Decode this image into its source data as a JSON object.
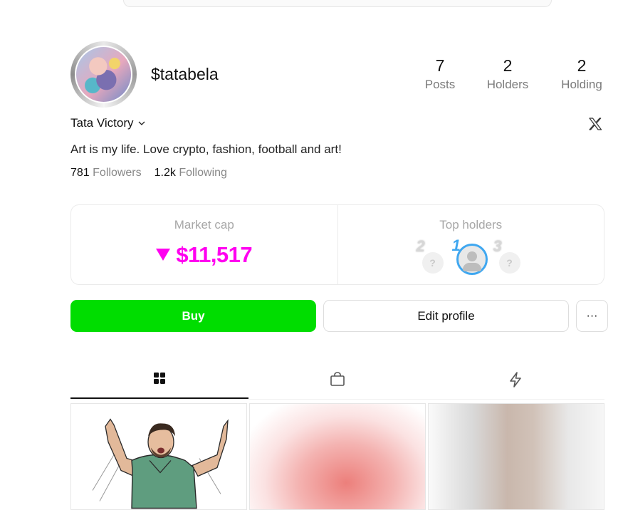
{
  "profile": {
    "handle": "$tatabela",
    "display_name": "Tata Victory",
    "bio": "Art is my life. Love crypto, fashion, football and art!",
    "followers_count": "781",
    "followers_label": "Followers",
    "following_count": "1.2k",
    "following_label": "Following"
  },
  "stats": [
    {
      "value": "7",
      "label": "Posts"
    },
    {
      "value": "2",
      "label": "Holders"
    },
    {
      "value": "2",
      "label": "Holding"
    }
  ],
  "market": {
    "label": "Market cap",
    "value": "$11,517",
    "trend": "down"
  },
  "top_holders": {
    "label": "Top holders",
    "ranks": [
      "2",
      "1",
      "3"
    ]
  },
  "actions": {
    "buy_label": "Buy",
    "edit_label": "Edit profile",
    "more_label": "···"
  },
  "tabs": [
    {
      "icon": "grid-icon",
      "active": true
    },
    {
      "icon": "shopping-bag-icon",
      "active": false
    },
    {
      "icon": "lightning-icon",
      "active": false
    }
  ],
  "colors": {
    "accent_buy": "#00dd00",
    "market_cap": "#ff00f0",
    "top_holder_ring": "#3fa7f0"
  }
}
